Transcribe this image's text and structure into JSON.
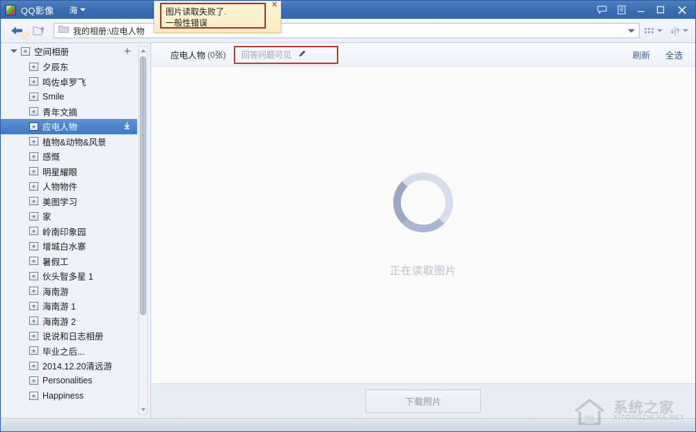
{
  "window": {
    "app_title": "QQ影像",
    "logo_icon": "qq-photo-logo-icon",
    "account_label": "海",
    "account_caret_icon": "chevron-down-icon",
    "feedback_icon": "chat-bubble-icon",
    "notes_icon": "clipboard-icon",
    "minimize_icon": "minimize-icon",
    "maximize_icon": "maximize-icon",
    "close_icon": "close-icon"
  },
  "toolbar": {
    "back_icon": "back-arrow-icon",
    "up_icon": "upload-folder-icon",
    "folder_icon": "folder-icon",
    "address_value": "我的相册:\\应电人物",
    "address_placeholder": "我的相册:\\",
    "address_dropdown_icon": "chevron-down-icon",
    "view_icon": "grid-view-icon",
    "view_caret_icon": "chevron-down-icon",
    "sort_icon": "sort-icon",
    "sort_caret_icon": "chevron-down-icon"
  },
  "sidebar": {
    "root": {
      "label": "空间相册",
      "expand_icon": "triangle-down-icon",
      "album_icon": "album-icon",
      "add_label": "+",
      "add_icon": "plus-icon"
    },
    "items": [
      {
        "label": "夕辰东",
        "selected": false
      },
      {
        "label": "鸣佐卓罗飞",
        "selected": false
      },
      {
        "label": "Smile",
        "selected": false
      },
      {
        "label": "青年文摘",
        "selected": false
      },
      {
        "label": "应电人物",
        "selected": true,
        "badge_icon": "download-arrow-icon"
      },
      {
        "label": "植物&动物&风景",
        "selected": false
      },
      {
        "label": "感慨",
        "selected": false
      },
      {
        "label": "明星耀眼",
        "selected": false
      },
      {
        "label": "人物物件",
        "selected": false
      },
      {
        "label": "美图学习",
        "selected": false
      },
      {
        "label": "家",
        "selected": false
      },
      {
        "label": "岭南印象园",
        "selected": false
      },
      {
        "label": "增城白水寨",
        "selected": false
      },
      {
        "label": "暑假工",
        "selected": false
      },
      {
        "label": "伙头智多星 1",
        "selected": false
      },
      {
        "label": "海南游",
        "selected": false
      },
      {
        "label": "海南游 1",
        "selected": false
      },
      {
        "label": "海南游 2",
        "selected": false
      },
      {
        "label": "说说和日志相册",
        "selected": false
      },
      {
        "label": "毕业之后...",
        "selected": false
      },
      {
        "label": "2014.12.20清远游",
        "selected": false
      },
      {
        "label": "Personalities",
        "selected": false
      },
      {
        "label": "Happiness",
        "selected": false
      }
    ],
    "scrollbar": {
      "up_icon": "scroll-up-arrow-icon",
      "down_icon": "scroll-down-arrow-icon"
    }
  },
  "content": {
    "album_name": "应电人物",
    "album_count": "(0张)",
    "permission_text": "回答问题可见",
    "permission_edit_icon": "pencil-icon",
    "refresh_label": "刷新",
    "select_all_label": "全选",
    "loading_text": "正在读取图片",
    "spinner_icon": "loading-spinner-icon",
    "download_button_label": "下载照片"
  },
  "error_popup": {
    "line1": "图片读取失败了.",
    "line2": "一般性错误",
    "close_icon": "close-icon",
    "close_label": "✕",
    "border_color": "#a93226",
    "background_color": "#f8edc4"
  },
  "watermark": {
    "text": "系统之家",
    "subtext": "XITONGZHIJIA.NET",
    "logo_icon": "house-logo-icon"
  },
  "colors": {
    "titlebar": "#3d6cb0",
    "selection": "#4f86cf",
    "accent_link": "#2d5fa8",
    "sidebar_bg": "#eef1f7",
    "content_bg": "#fafafa",
    "error_border": "#a93226"
  }
}
